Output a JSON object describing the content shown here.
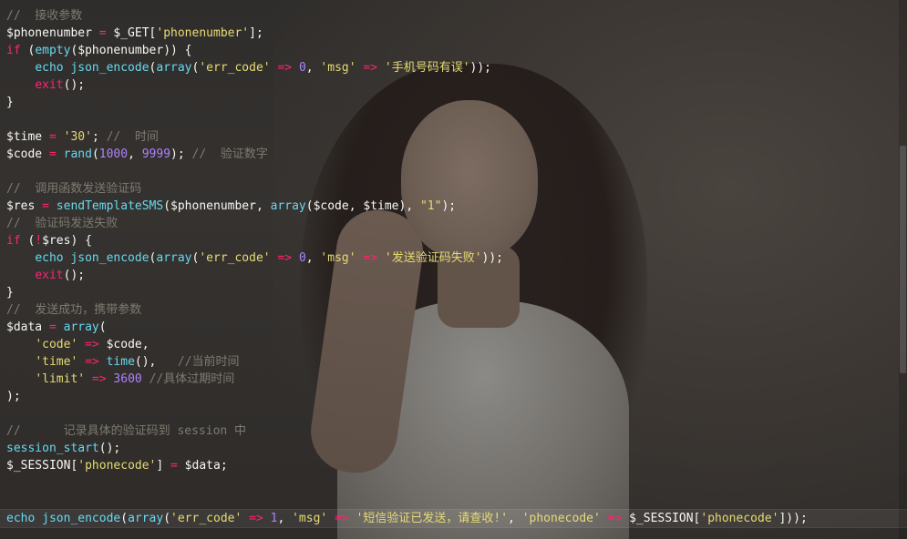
{
  "colors": {
    "comment": "#7d7b70",
    "keyword": "#f92672",
    "function": "#66d9ef",
    "string": "#e6db74",
    "number": "#ae81ff",
    "plain": "#f8f8f2"
  },
  "editor": {
    "current_line_index": 29,
    "lines": [
      [
        {
          "t": "comment",
          "v": "//  接收参数"
        }
      ],
      [
        {
          "t": "plain",
          "v": "$phonenumber "
        },
        {
          "t": "op",
          "v": "="
        },
        {
          "t": "plain",
          "v": " $_GET["
        },
        {
          "t": "string",
          "v": "'phonenumber'"
        },
        {
          "t": "plain",
          "v": "];"
        }
      ],
      [
        {
          "t": "keyword",
          "v": "if"
        },
        {
          "t": "plain",
          "v": " ("
        },
        {
          "t": "func",
          "v": "empty"
        },
        {
          "t": "plain",
          "v": "($phonenumber)) {"
        }
      ],
      [
        {
          "t": "plain",
          "v": "    "
        },
        {
          "t": "func",
          "v": "echo json_encode"
        },
        {
          "t": "plain",
          "v": "("
        },
        {
          "t": "func",
          "v": "array"
        },
        {
          "t": "plain",
          "v": "("
        },
        {
          "t": "string",
          "v": "'err_code'"
        },
        {
          "t": "plain",
          "v": " "
        },
        {
          "t": "op",
          "v": "=>"
        },
        {
          "t": "plain",
          "v": " "
        },
        {
          "t": "number",
          "v": "0"
        },
        {
          "t": "plain",
          "v": ", "
        },
        {
          "t": "string",
          "v": "'msg'"
        },
        {
          "t": "plain",
          "v": " "
        },
        {
          "t": "op",
          "v": "=>"
        },
        {
          "t": "plain",
          "v": " "
        },
        {
          "t": "string",
          "v": "'手机号码有误'"
        },
        {
          "t": "plain",
          "v": "));"
        }
      ],
      [
        {
          "t": "plain",
          "v": "    "
        },
        {
          "t": "keyword",
          "v": "exit"
        },
        {
          "t": "plain",
          "v": "();"
        }
      ],
      [
        {
          "t": "plain",
          "v": "}"
        }
      ],
      [],
      [
        {
          "t": "plain",
          "v": "$time "
        },
        {
          "t": "op",
          "v": "="
        },
        {
          "t": "plain",
          "v": " "
        },
        {
          "t": "string",
          "v": "'30'"
        },
        {
          "t": "plain",
          "v": "; "
        },
        {
          "t": "comment",
          "v": "//  时间"
        }
      ],
      [
        {
          "t": "plain",
          "v": "$code "
        },
        {
          "t": "op",
          "v": "="
        },
        {
          "t": "plain",
          "v": " "
        },
        {
          "t": "func",
          "v": "rand"
        },
        {
          "t": "plain",
          "v": "("
        },
        {
          "t": "number",
          "v": "1000"
        },
        {
          "t": "plain",
          "v": ", "
        },
        {
          "t": "number",
          "v": "9999"
        },
        {
          "t": "plain",
          "v": "); "
        },
        {
          "t": "comment",
          "v": "//  验证数字"
        }
      ],
      [],
      [
        {
          "t": "comment",
          "v": "//  调用函数发送验证码"
        }
      ],
      [
        {
          "t": "plain",
          "v": "$res "
        },
        {
          "t": "op",
          "v": "="
        },
        {
          "t": "plain",
          "v": " "
        },
        {
          "t": "func",
          "v": "sendTemplateSMS"
        },
        {
          "t": "plain",
          "v": "($phonenumber, "
        },
        {
          "t": "func",
          "v": "array"
        },
        {
          "t": "plain",
          "v": "($code, $time), "
        },
        {
          "t": "string",
          "v": "\"1\""
        },
        {
          "t": "plain",
          "v": ");"
        }
      ],
      [
        {
          "t": "comment",
          "v": "//  验证码发送失败"
        }
      ],
      [
        {
          "t": "keyword",
          "v": "if"
        },
        {
          "t": "plain",
          "v": " ("
        },
        {
          "t": "op",
          "v": "!"
        },
        {
          "t": "plain",
          "v": "$res) {"
        }
      ],
      [
        {
          "t": "plain",
          "v": "    "
        },
        {
          "t": "func",
          "v": "echo json_encode"
        },
        {
          "t": "plain",
          "v": "("
        },
        {
          "t": "func",
          "v": "array"
        },
        {
          "t": "plain",
          "v": "("
        },
        {
          "t": "string",
          "v": "'err_code'"
        },
        {
          "t": "plain",
          "v": " "
        },
        {
          "t": "op",
          "v": "=>"
        },
        {
          "t": "plain",
          "v": " "
        },
        {
          "t": "number",
          "v": "0"
        },
        {
          "t": "plain",
          "v": ", "
        },
        {
          "t": "string",
          "v": "'msg'"
        },
        {
          "t": "plain",
          "v": " "
        },
        {
          "t": "op",
          "v": "=>"
        },
        {
          "t": "plain",
          "v": " "
        },
        {
          "t": "string",
          "v": "'发送验证码失败'"
        },
        {
          "t": "plain",
          "v": "));"
        }
      ],
      [
        {
          "t": "plain",
          "v": "    "
        },
        {
          "t": "keyword",
          "v": "exit"
        },
        {
          "t": "plain",
          "v": "();"
        }
      ],
      [
        {
          "t": "plain",
          "v": "}"
        }
      ],
      [
        {
          "t": "comment",
          "v": "//  发送成功，携带参数"
        }
      ],
      [
        {
          "t": "plain",
          "v": "$data "
        },
        {
          "t": "op",
          "v": "="
        },
        {
          "t": "plain",
          "v": " "
        },
        {
          "t": "func",
          "v": "array"
        },
        {
          "t": "plain",
          "v": "("
        }
      ],
      [
        {
          "t": "plain",
          "v": "    "
        },
        {
          "t": "string",
          "v": "'code'"
        },
        {
          "t": "plain",
          "v": " "
        },
        {
          "t": "op",
          "v": "=>"
        },
        {
          "t": "plain",
          "v": " $code,"
        }
      ],
      [
        {
          "t": "plain",
          "v": "    "
        },
        {
          "t": "string",
          "v": "'time'"
        },
        {
          "t": "plain",
          "v": " "
        },
        {
          "t": "op",
          "v": "=>"
        },
        {
          "t": "plain",
          "v": " "
        },
        {
          "t": "func",
          "v": "time"
        },
        {
          "t": "plain",
          "v": "(),   "
        },
        {
          "t": "comment",
          "v": "//当前时间"
        }
      ],
      [
        {
          "t": "plain",
          "v": "    "
        },
        {
          "t": "string",
          "v": "'limit'"
        },
        {
          "t": "plain",
          "v": " "
        },
        {
          "t": "op",
          "v": "=>"
        },
        {
          "t": "plain",
          "v": " "
        },
        {
          "t": "number",
          "v": "3600"
        },
        {
          "t": "plain",
          "v": " "
        },
        {
          "t": "comment",
          "v": "//具体过期时间"
        }
      ],
      [
        {
          "t": "plain",
          "v": ");"
        }
      ],
      [],
      [
        {
          "t": "comment",
          "v": "//      记录具体的验证码到 session 中"
        }
      ],
      [
        {
          "t": "func",
          "v": "session_start"
        },
        {
          "t": "plain",
          "v": "();"
        }
      ],
      [
        {
          "t": "plain",
          "v": "$_SESSION["
        },
        {
          "t": "string",
          "v": "'phonecode'"
        },
        {
          "t": "plain",
          "v": "] "
        },
        {
          "t": "op",
          "v": "="
        },
        {
          "t": "plain",
          "v": " $data;"
        }
      ],
      [],
      [],
      [
        {
          "t": "func",
          "v": "echo json_encode"
        },
        {
          "t": "plain",
          "v": "("
        },
        {
          "t": "func",
          "v": "array"
        },
        {
          "t": "plain",
          "v": "("
        },
        {
          "t": "string",
          "v": "'err_code'"
        },
        {
          "t": "plain",
          "v": " "
        },
        {
          "t": "op",
          "v": "=>"
        },
        {
          "t": "plain",
          "v": " "
        },
        {
          "t": "number",
          "v": "1"
        },
        {
          "t": "plain",
          "v": ", "
        },
        {
          "t": "string",
          "v": "'msg'"
        },
        {
          "t": "plain",
          "v": " "
        },
        {
          "t": "op",
          "v": "=>"
        },
        {
          "t": "plain",
          "v": " "
        },
        {
          "t": "string",
          "v": "'短信验证已发送，请查收!'"
        },
        {
          "t": "plain",
          "v": ", "
        },
        {
          "t": "string",
          "v": "'phonecode'"
        },
        {
          "t": "plain",
          "v": " "
        },
        {
          "t": "op",
          "v": "=>"
        },
        {
          "t": "plain",
          "v": " $_SESSION["
        },
        {
          "t": "string",
          "v": "'phonecode'"
        },
        {
          "t": "plain",
          "v": "]));"
        }
      ]
    ]
  }
}
